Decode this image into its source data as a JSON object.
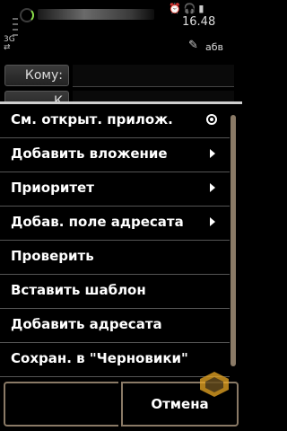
{
  "status": {
    "clock": "16.48",
    "network": "3G",
    "input_mode": "абв"
  },
  "compose": {
    "to_label": "Кому:",
    "cc_label": "К"
  },
  "menu": {
    "items": [
      {
        "label": "См. открыт. прилож.",
        "marker": "radio"
      },
      {
        "label": "Добавить вложение",
        "marker": "arrow"
      },
      {
        "label": "Приоритет",
        "marker": "arrow"
      },
      {
        "label": "Добав. поле адресата",
        "marker": "arrow"
      },
      {
        "label": "Проверить",
        "marker": ""
      },
      {
        "label": "Вставить шаблон",
        "marker": ""
      },
      {
        "label": "Добавить адресата",
        "marker": ""
      },
      {
        "label": "Сохран. в \"Черновики\"",
        "marker": ""
      }
    ]
  },
  "softkeys": {
    "right": "Отмена"
  },
  "colors": {
    "frame": "#8a7a66",
    "signal": "#8be04a"
  }
}
